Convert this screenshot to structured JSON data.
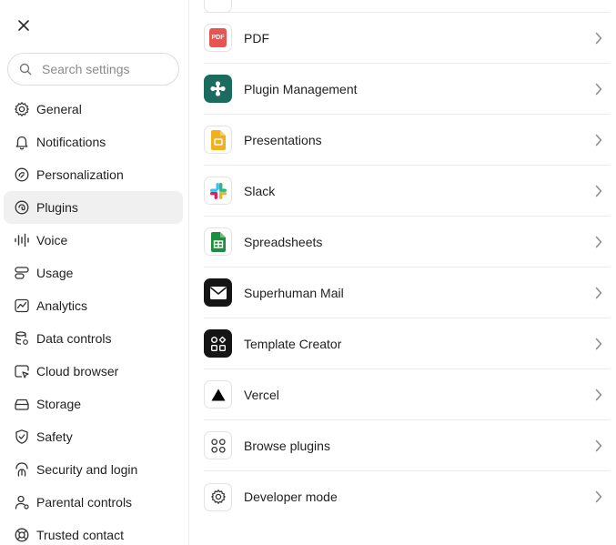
{
  "search": {
    "placeholder": "Search settings"
  },
  "sidebar": {
    "items": [
      {
        "label": "General",
        "icon": "gear-icon"
      },
      {
        "label": "Notifications",
        "icon": "bell-icon"
      },
      {
        "label": "Personalization",
        "icon": "personalization-icon"
      },
      {
        "label": "Plugins",
        "icon": "plugin-icon",
        "active": true
      },
      {
        "label": "Voice",
        "icon": "waveform-icon"
      },
      {
        "label": "Usage",
        "icon": "usage-icon"
      },
      {
        "label": "Analytics",
        "icon": "analytics-icon"
      },
      {
        "label": "Data controls",
        "icon": "database-icon"
      },
      {
        "label": "Cloud browser",
        "icon": "cloud-browser-icon"
      },
      {
        "label": "Storage",
        "icon": "storage-icon"
      },
      {
        "label": "Safety",
        "icon": "shield-icon"
      },
      {
        "label": "Security and login",
        "icon": "security-icon"
      },
      {
        "label": "Parental controls",
        "icon": "parental-icon"
      },
      {
        "label": "Trusted contact",
        "icon": "lifebuoy-icon"
      }
    ]
  },
  "plugins": {
    "items": [
      {
        "label": "PDF",
        "icon": "pdf-icon"
      },
      {
        "label": "Plugin Management",
        "icon": "plugin-management-icon"
      },
      {
        "label": "Presentations",
        "icon": "presentations-icon"
      },
      {
        "label": "Slack",
        "icon": "slack-icon"
      },
      {
        "label": "Spreadsheets",
        "icon": "spreadsheets-icon"
      },
      {
        "label": "Superhuman Mail",
        "icon": "mail-icon"
      },
      {
        "label": "Template Creator",
        "icon": "template-icon"
      },
      {
        "label": "Vercel",
        "icon": "vercel-icon"
      },
      {
        "label": "Browse plugins",
        "icon": "browse-icon"
      },
      {
        "label": "Developer mode",
        "icon": "gear-icon"
      }
    ]
  },
  "pdf_badge": "PDF",
  "colors": {
    "active_bg": "#f0f0f0",
    "divider": "#ececec",
    "text": "#1f1f1f",
    "pdf": "#e8544f",
    "plugin_management": "#1b6b5e",
    "presentations": "#f2b01e",
    "spreadsheets": "#1e8e3e"
  }
}
